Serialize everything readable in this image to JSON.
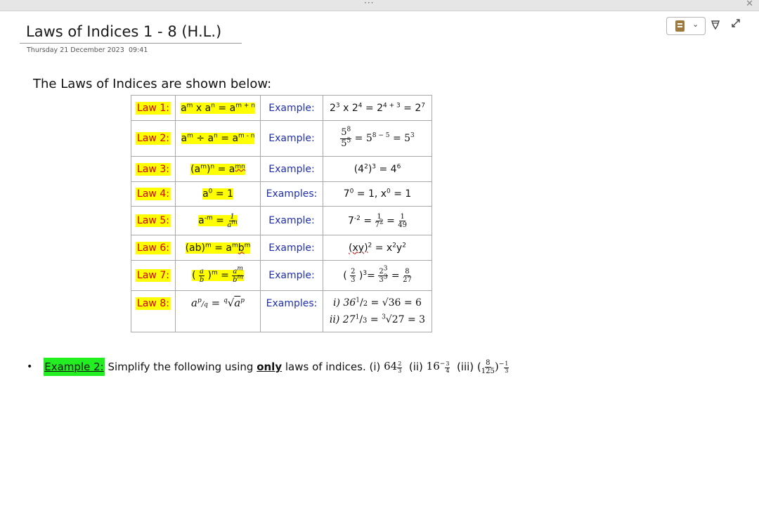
{
  "window": {
    "menu_dots": "···",
    "close_glyph": "✕"
  },
  "page": {
    "title": "Laws of Indices 1 - 8 (H.L.)",
    "date": "Thursday 21 December 2023",
    "time": "09:41"
  },
  "toolbar": {
    "notebook_icon": "notebook-icon",
    "dropdown_glyph": "⌄",
    "pen_glyph": "♡",
    "expand_glyph": "⤢"
  },
  "heading": "The Laws of Indices are shown below:",
  "laws": {
    "labels": [
      "Law 1:",
      "Law 2:",
      "Law 3:",
      "Law 4:",
      "Law 5:",
      "Law 6:",
      "Law 7:",
      "Law 8:"
    ],
    "example_label": "Example:",
    "examples_label": "Examples:",
    "l1": {
      "a": "a",
      "m": "m",
      "x": " x ",
      "a2": "a",
      "n": "n",
      "eq": " = ",
      "a3": "a",
      "mn": "m + n",
      "ex": "2",
      "e3": "3",
      "x2": " x 2",
      "e4": "4",
      "eq2": " = 2",
      "e34": "4 + 3",
      "eq3": " = 2",
      "e7": "7"
    },
    "l2": {
      "a": "a",
      "m": "m",
      "div": " ÷ a",
      "n": "n",
      "eq": " = a",
      "mn": "m - n",
      "num": "5",
      "num_e": "8",
      "den": "5",
      "den_e": "5",
      "rhs1": " = 5",
      "rhs1_e": "8 − 5",
      "rhs2": " = 5",
      "rhs2_e": "3"
    },
    "l3": {
      "lhs": "(a",
      "m": "m",
      "mid": ")",
      "n": "n",
      "eq": " = a",
      "mn": "mn",
      "ex": "(4",
      "e2": "2",
      ")": ")",
      "e3": "3",
      "eq2": " = 4",
      "e6": "6"
    },
    "l4": {
      "a": "a",
      "z": "0",
      "eq": " = 1",
      "ex1": "7",
      "e0": "0",
      "mid": " = 1, x",
      "e0b": "0",
      "end": " = 1"
    },
    "l5": {
      "a": "a",
      "m": "-m",
      "eq": " = ",
      "num": "1",
      "den": "a",
      "den_e": "m",
      "ex": "7",
      "e2": "-2",
      "eq2": " = ",
      "n2": "1",
      "d2": "7",
      "d2e": "2",
      "eq3": " = ",
      "n3": "1",
      "d3": "49"
    },
    "l6": {
      "lhs": "(ab)",
      "m": "m",
      "eq": " = a",
      "m2": "m",
      "b": "b",
      "m3": "m",
      "ex": "(xy)",
      "e2": "2",
      "eq2": " = x",
      "e2b": "2",
      "y": "y",
      "e2c": "2"
    },
    "l7": {
      "open": "( ",
      "a": "a",
      "b": "b",
      "close": " )",
      "m": "m",
      "eq": " = ",
      "num": "a",
      "num_e": "m",
      "den": "b",
      "den_e": "m",
      "ex_open": "( ",
      "n": "2",
      "d": "3",
      "ex_close": " )",
      "e3": "3",
      "eq2": "= ",
      "n2": "2",
      "n2e": "3",
      "d2": "3",
      "d2e": "3",
      "eq3": " = ",
      "n3": "8",
      "d3": "27"
    },
    "l8": {
      "a": "a",
      "pq": "p",
      "slash": "/",
      "q": "q",
      "eq": " = ",
      "root_idx": "q",
      "root": "√",
      "ap": "a",
      "p": "p",
      "i": "i) 36",
      "ih": "1",
      "is": "/",
      "i2": "2",
      "ieq": " = √36 = 6",
      "ii": "ii) 27",
      "iih": "1",
      "iis": "/",
      "ii3": "3",
      "iieq": " = ",
      "iiroot_idx": "3",
      "iiroot": "√27 = 3"
    }
  },
  "example2": {
    "bullet": "•",
    "label": "Example 2:",
    "text1": " Simplify the following using ",
    "only": "only",
    "text2": " laws of indices. (i) ",
    "q1_base": "64",
    "q1_exp_n": "2",
    "q1_exp_d": "3",
    "q2_label": "  (ii) ",
    "q2_base": "16",
    "q2_exp_sign": "−",
    "q2_exp_n": "3",
    "q2_exp_d": "4",
    "q3_label": "  (iii) (",
    "q3_n": "8",
    "q3_d": "125",
    "q3_close": ")",
    "q3_exp_sign": "−",
    "q3_exp_n": "1",
    "q3_exp_d": "3"
  }
}
